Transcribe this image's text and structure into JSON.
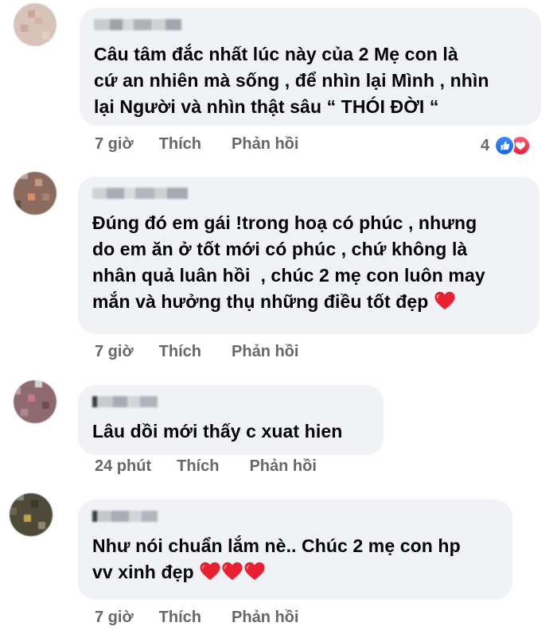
{
  "comments": [
    {
      "text": "Câu tâm đắc nhất lúc này của 2 Mẹ con là\ncứ an nhiên mà sống , để nhìn lại Mình , nhìn\nlại Người và nhìn thật sâu “ THÓI ĐỜI “",
      "time": "7 giờ",
      "like_label": "Thích",
      "reply_label": "Phản hồi",
      "reaction_count": "4"
    },
    {
      "text": "Đúng đó em gái !trong hoạ có phúc , nhưng\ndo em ăn ở tốt mới có phúc , chứ không là\nnhân quả luân hồi  , chúc 2 mẹ con luôn may\nmắn và hưởng thụ những điều tốt đẹp ",
      "hearts": "1",
      "time": "7 giờ",
      "like_label": "Thích",
      "reply_label": "Phản hồi"
    },
    {
      "text": "Lâu dồi mới thấy c xuat hien",
      "time": "24 phút",
      "like_label": "Thích",
      "reply_label": "Phản hồi"
    },
    {
      "text": "Như nói chuẩn lắm nè.. Chúc 2 mẹ con hp\nvv xinh đẹp ",
      "hearts": "3",
      "time": "7 giờ",
      "like_label": "Thích",
      "reply_label": "Phản hồi"
    }
  ],
  "icons": {
    "like": "like-reaction-icon",
    "love": "love-reaction-icon",
    "heart_emoji": "red-heart-emoji"
  },
  "colors": {
    "bubble": "#f0f2f5",
    "meta": "#65676b",
    "text": "#050505",
    "like_blue": "#1877f2",
    "love_red": "#e41e3f"
  }
}
